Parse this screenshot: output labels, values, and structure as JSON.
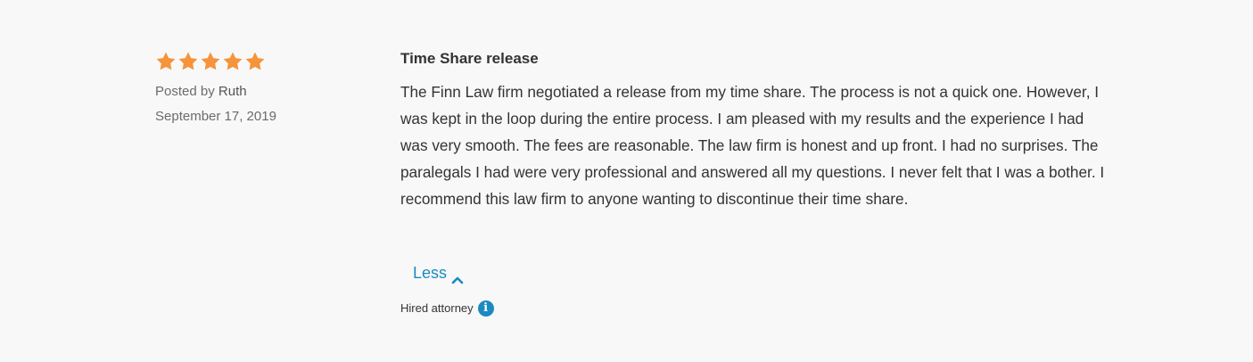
{
  "review": {
    "rating": 5,
    "rating_max": 5,
    "posted_by_prefix": "Posted by",
    "author": "Ruth",
    "date": "September 17, 2019",
    "title": "Time Share release",
    "body": "The Finn Law firm negotiated a release from my time share. The process is not a quick one. However, I was kept in the loop during the entire process. I am pleased with my results and the experience I had was very smooth. The fees are reasonable. The law firm is honest and up front. I had no surprises. The paralegals I had were very professional and answered all my questions. I never felt that I was a bother. I recommend this law firm to anyone wanting to discontinue their time share.",
    "toggle_label": "Less",
    "hired_label": "Hired attorney",
    "info_glyph": "i"
  },
  "colors": {
    "star": "#f5943a",
    "link": "#1a8bc0",
    "background": "#f8f8f8",
    "text": "#333333",
    "muted": "#6b6b6b"
  },
  "icons": {
    "star": "star-icon",
    "toggle": "chevron-up-icon",
    "info": "info-icon"
  }
}
